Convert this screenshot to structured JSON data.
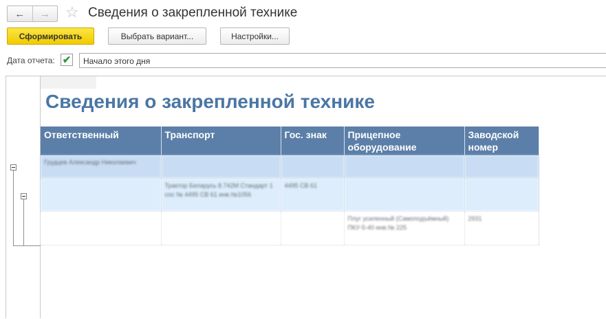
{
  "window": {
    "title": "Сведения о закрепленной технике"
  },
  "toolbar": {
    "generate": "Сформировать",
    "choose_variant": "Выбрать вариант...",
    "settings": "Настройки..."
  },
  "params": {
    "date_label": "Дата отчета:",
    "date_value": "Начало этого дня",
    "date_checked": true
  },
  "report": {
    "title": "Сведения о закрепленной технике",
    "columns": [
      "Ответственный",
      "Транспорт",
      "Гос. знак",
      "Прицепное оборудование",
      "Заводской номер"
    ],
    "rows": [
      {
        "level": 1,
        "cells": [
          "Грудцев Александр Николаевич",
          "",
          "",
          "",
          ""
        ]
      },
      {
        "level": 2,
        "cells": [
          "",
          "Трактор Беларусь 8.742М Стандарт 1 сос № 4495 СВ 61 инв.№1056",
          "4495 СВ 61",
          "",
          ""
        ]
      },
      {
        "level": 3,
        "cells": [
          "",
          "",
          "",
          "Плуг усиленный (Самоподъёмный) ПКУ-5-40 инв.№ 225",
          "2931"
        ]
      }
    ]
  },
  "colors": {
    "accent": "#f1cb00",
    "header": "#5b7fa8",
    "title": "#4a76a4"
  }
}
